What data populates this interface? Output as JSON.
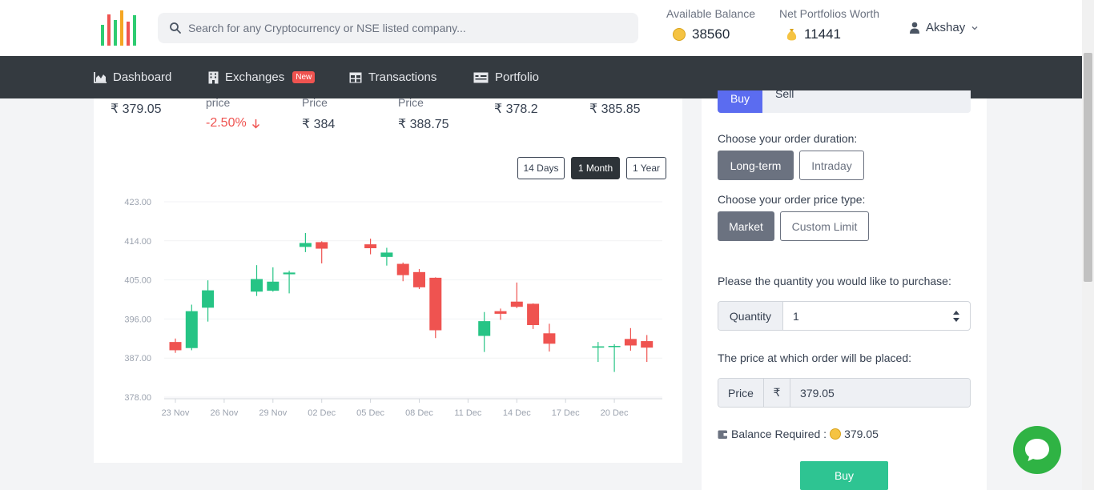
{
  "header": {
    "search_placeholder": "Search for any Cryptocurrency or NSE listed company...",
    "available_balance_label": "Available Balance",
    "available_balance_value": "38560",
    "net_worth_label": "Net Portfolios Worth",
    "net_worth_value": "11441",
    "user_name": "Akshay",
    "icons": [
      "logo-bars",
      "search-icon",
      "coin-icon",
      "money-bag-icon",
      "user-icon",
      "chevron-down-icon"
    ]
  },
  "nav": {
    "items": [
      {
        "label": "Dashboard",
        "icon": "area-chart-icon"
      },
      {
        "label": "Exchanges",
        "icon": "building-icon",
        "badge": "New"
      },
      {
        "label": "Transactions",
        "icon": "table-icon"
      },
      {
        "label": "Portfolio",
        "icon": "money-bill-icon"
      }
    ]
  },
  "stock_summary": [
    {
      "label": "",
      "value": "₹ 379.05"
    },
    {
      "label": "price",
      "value": "-2.50%",
      "trend": "down"
    },
    {
      "label": "Price",
      "value": "₹ 384"
    },
    {
      "label": "Price",
      "value": "₹ 388.75"
    },
    {
      "label": "",
      "value": "₹ 378.2"
    },
    {
      "label": "",
      "value": "₹ 385.85"
    }
  ],
  "range_buttons": [
    {
      "label": "14 Days",
      "active": false
    },
    {
      "label": "1 Month",
      "active": true
    },
    {
      "label": "1 Year",
      "active": false
    }
  ],
  "chart_data": {
    "type": "candlestick",
    "title": "",
    "xlabel": "",
    "ylabel": "",
    "ylim": [
      378,
      423
    ],
    "yticks": [
      "423.00",
      "414.00",
      "405.00",
      "396.00",
      "387.00",
      "378.00"
    ],
    "xticks": [
      "23 Nov",
      "26 Nov",
      "29 Nov",
      "02 Dec",
      "05 Dec",
      "08 Dec",
      "11 Dec",
      "14 Dec",
      "17 Dec",
      "20 Dec"
    ],
    "grid": "horizontal",
    "colors": {
      "up": "#26c485",
      "down": "#ef5350"
    },
    "candles": [
      {
        "date": "23 Nov",
        "open": 390.7,
        "high": 391.5,
        "low": 388.2,
        "close": 388.8
      },
      {
        "date": "24 Nov",
        "open": 389.3,
        "high": 399.3,
        "low": 388.8,
        "close": 397.8
      },
      {
        "date": "25 Nov",
        "open": 398.6,
        "high": 404.9,
        "low": 395.4,
        "close": 402.6
      },
      {
        "date": "28 Nov",
        "open": 402.3,
        "high": 408.4,
        "low": 401.3,
        "close": 405.2
      },
      {
        "date": "29 Nov",
        "open": 402.5,
        "high": 407.9,
        "low": 402.3,
        "close": 404.6
      },
      {
        "date": "30 Nov",
        "open": 406.3,
        "high": 407.1,
        "low": 401.9,
        "close": 406.7
      },
      {
        "date": "01 Dec",
        "open": 412.6,
        "high": 415.8,
        "low": 411.4,
        "close": 413.5
      },
      {
        "date": "02 Dec",
        "open": 413.7,
        "high": 413.9,
        "low": 408.8,
        "close": 412.2
      },
      {
        "date": "05 Dec",
        "open": 413.2,
        "high": 414.5,
        "low": 410.9,
        "close": 412.3
      },
      {
        "date": "06 Dec",
        "open": 410.3,
        "high": 412.4,
        "low": 408.3,
        "close": 411.3
      },
      {
        "date": "07 Dec",
        "open": 408.7,
        "high": 409.0,
        "low": 404.7,
        "close": 406.1
      },
      {
        "date": "08 Dec",
        "open": 406.8,
        "high": 407.5,
        "low": 402.9,
        "close": 403.3
      },
      {
        "date": "09 Dec",
        "open": 405.5,
        "high": 405.6,
        "low": 391.6,
        "close": 393.4
      },
      {
        "date": "12 Dec",
        "open": 392.1,
        "high": 397.6,
        "low": 388.4,
        "close": 395.5
      },
      {
        "date": "13 Dec",
        "open": 397.8,
        "high": 398.4,
        "low": 395.8,
        "close": 397.2
      },
      {
        "date": "14 Dec",
        "open": 400.0,
        "high": 404.4,
        "low": 398.5,
        "close": 398.8
      },
      {
        "date": "15 Dec",
        "open": 399.5,
        "high": 399.6,
        "low": 393.7,
        "close": 394.6
      },
      {
        "date": "16 Dec",
        "open": 392.7,
        "high": 394.9,
        "low": 388.5,
        "close": 390.3
      },
      {
        "date": "19 Dec",
        "open": 389.4,
        "high": 390.7,
        "low": 386.1,
        "close": 389.7
      },
      {
        "date": "20 Dec",
        "open": 389.7,
        "high": 390.2,
        "low": 383.8,
        "close": 389.8
      },
      {
        "date": "21 Dec",
        "open": 391.4,
        "high": 393.9,
        "low": 388.7,
        "close": 389.9
      },
      {
        "date": "22 Dec",
        "open": 390.9,
        "high": 392.3,
        "low": 386.1,
        "close": 389.4
      }
    ]
  },
  "order_panel": {
    "tab_buy": "Buy",
    "tab_sell": "Sell",
    "duration_label": "Choose your order duration:",
    "duration_options": [
      "Long-term",
      "Intraday"
    ],
    "price_type_label": "Choose your order price type:",
    "price_type_options": [
      "Market",
      "Custom Limit"
    ],
    "quantity_prompt": "Please the quantity you would like to purchase:",
    "quantity_label": "Quantity",
    "quantity_value": "1",
    "price_prompt": "The price at which order will be placed:",
    "price_label": "Price",
    "currency_symbol": "₹",
    "price_value": "379.05",
    "balance_required_label": "Balance Required :",
    "balance_required_value": "379.05",
    "buy_button": "Buy"
  }
}
